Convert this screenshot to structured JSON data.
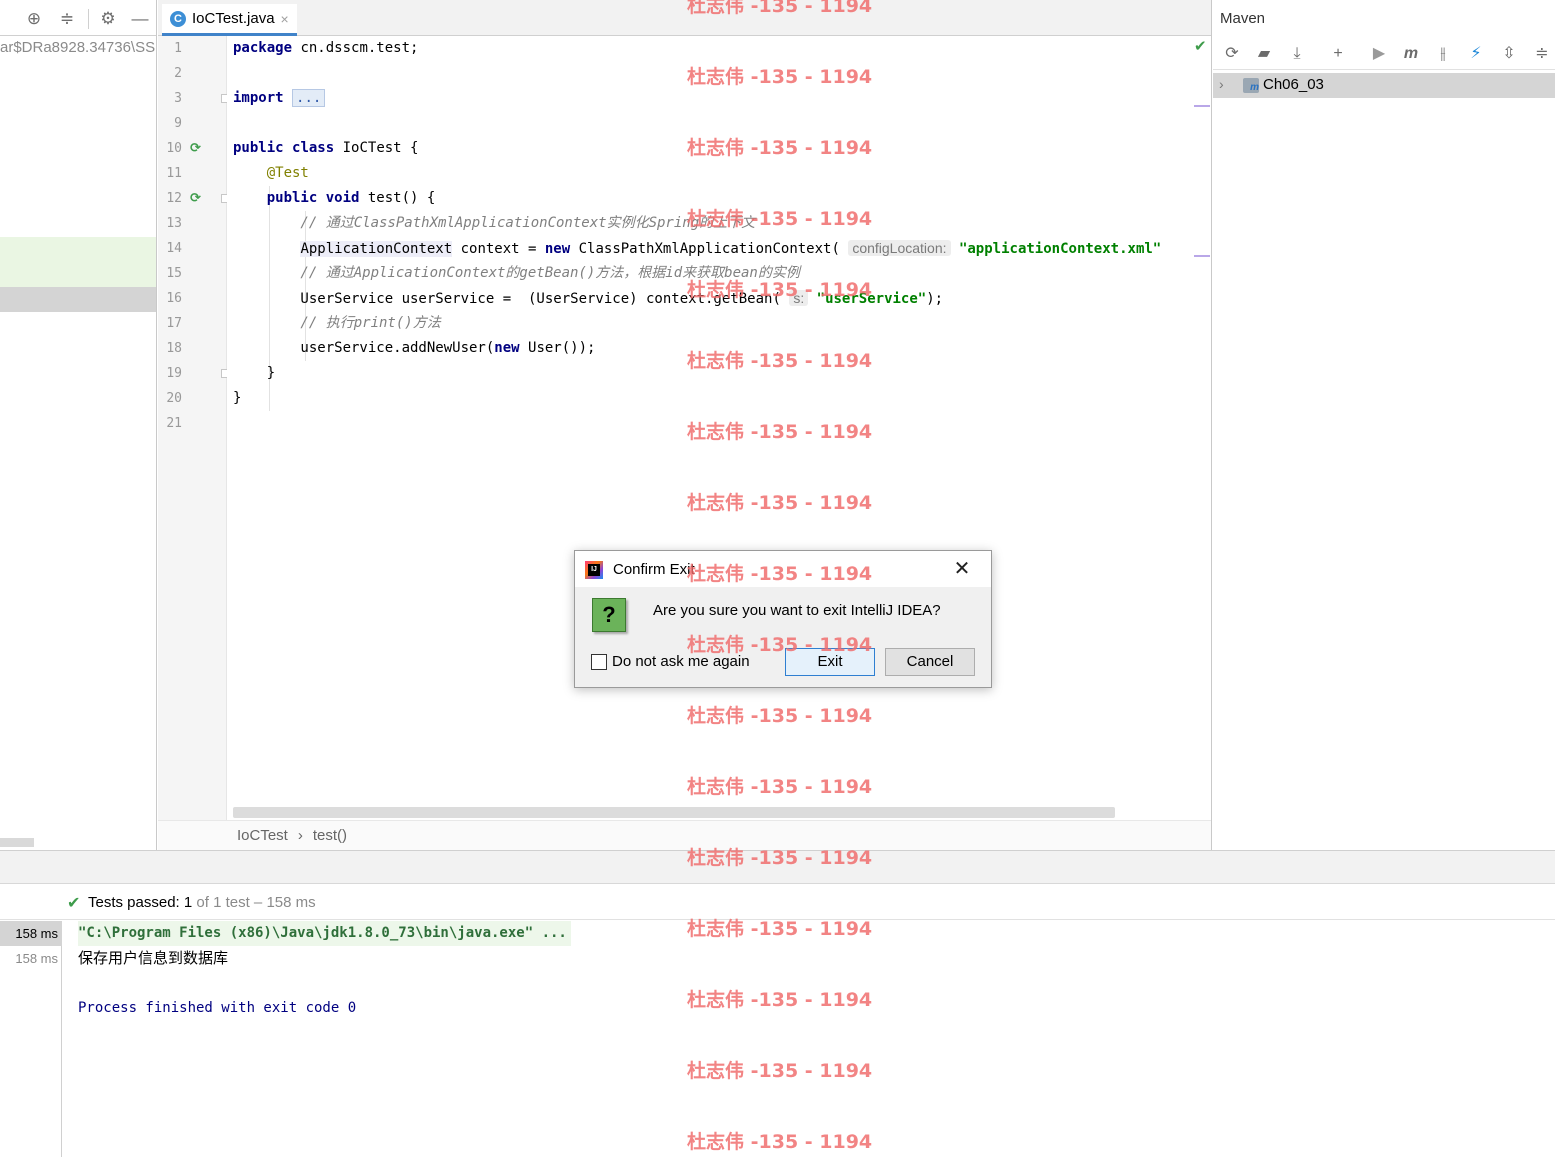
{
  "project_panel": {
    "path_text": "ar$DRa8928.34736\\SS"
  },
  "editor": {
    "tab": {
      "label": "IoCTest.java",
      "close": "×",
      "icon_letter": "C"
    },
    "line_numbers": [
      "1",
      "2",
      "3",
      "9",
      "10",
      "11",
      "12",
      "13",
      "14",
      "15",
      "16",
      "17",
      "18",
      "19",
      "20",
      "21"
    ],
    "code": {
      "l1_kw": "package",
      "l1_rest": " cn.dsscm.test;",
      "l3_kw": "import",
      "l3_fold": "...",
      "l10_kw1": "public",
      "l10_kw2": "class",
      "l10_rest": " IoCTest {",
      "l11_ann": "    @Test",
      "l12_kw1": "    public",
      "l12_kw2": "void",
      "l12_rest": " test() {",
      "l13_cmt": "        // 通过ClassPathXmlApplicationContext实例化Spring的上下文",
      "l14_indent": "        ",
      "l14_type": "ApplicationContext",
      "l14_mid": " context = ",
      "l14_kw": "new",
      "l14_cls": " ClassPathXmlApplicationContext(",
      "l14_hint": "configLocation:",
      "l14_str": " \"applicationContext.xml\"",
      "l15_cmt": "        // 通过ApplicationContext的getBean()方法，根据id来获取bean的实例",
      "l16_pre": "        UserService userService =  (UserService) context.getBean(",
      "l16_hint": "s:",
      "l16_str": "\"userService\"",
      "l16_post": ");",
      "l17_cmt": "        // 执行print()方法",
      "l18_pre": "        userService.addNewUser(",
      "l18_kw": "new",
      "l18_post": " User());",
      "l19": "    }",
      "l20": "}"
    },
    "breadcrumb": {
      "class_name": "IoCTest",
      "separator": "›",
      "method_name": "test()"
    }
  },
  "maven": {
    "title": "Maven",
    "module": "Ch06_03",
    "toolbar_icons": [
      "reload-icon",
      "add-maven-project-icon",
      "download-icon",
      "plus-icon",
      "run-icon",
      "maven-goal-icon",
      "toggle-offline-icon",
      "skip-tests-icon",
      "show-dependencies-icon",
      "collapse-all-icon"
    ]
  },
  "run": {
    "tests_passed_label": "Tests passed:",
    "tests_passed_count": "1",
    "tests_rest": " of 1 test – 158 ms",
    "times": [
      "158 ms",
      "158 ms"
    ],
    "console": {
      "command": "\"C:\\Program Files (x86)\\Java\\jdk1.8.0_73\\bin\\java.exe\" ...",
      "output": "保存用户信息到数据库",
      "exit": "Process finished with exit code 0"
    }
  },
  "dialog": {
    "title": "Confirm Exit",
    "message": "Are you sure you want to exit IntelliJ IDEA?",
    "checkbox_label": "Do not ask me again",
    "checkbox_checked": false,
    "exit_label": "Exit",
    "cancel_label": "Cancel",
    "close": "✕"
  },
  "watermark": {
    "text": "杜志伟 -135 - 1194"
  },
  "colors": {
    "keyword": "#000080",
    "string": "#008000",
    "annotation": "#808000",
    "comment": "#808080",
    "watermark": "#f06a6a",
    "pass_green": "#3e9c4b"
  }
}
